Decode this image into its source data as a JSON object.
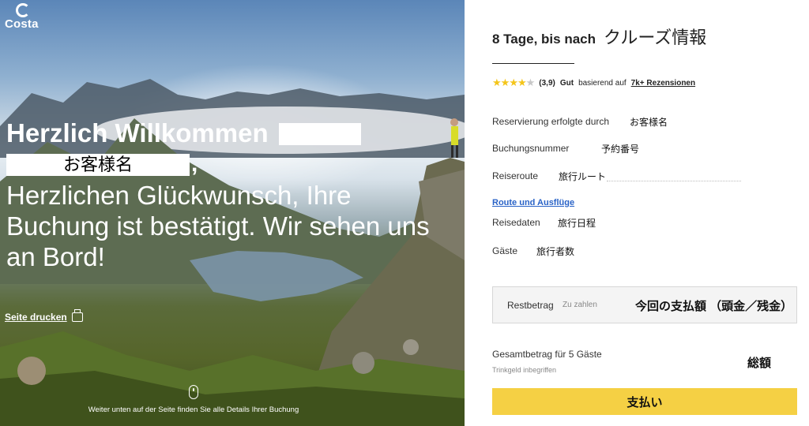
{
  "hero": {
    "logo_text": "Costa",
    "title": "Herzlich Willkommen",
    "name_placeholder": "お客様名",
    "comma": ",",
    "body": "Herzlichen Glückwunsch, Ihre Buchung ist bestätigt. Wir sehen uns an Bord!",
    "print_label": "Seite drucken",
    "scroll_hint": "Weiter unten auf der Seite finden Sie alle Details Ihrer Buchung"
  },
  "panel": {
    "title": "8 Tage, bis nach",
    "title_jp": "クルーズ情報",
    "rating": {
      "stars_filled": 4,
      "stars_total": 5,
      "score": "(3,9)",
      "word": "Gut",
      "based_on": "basierend auf",
      "reviews": "7k+ Rezensionen"
    },
    "rows": {
      "reservation_label": "Reservierung erfolgte durch",
      "reservation_value": "お客様名",
      "booking_label": "Buchungsnummer",
      "booking_value": "予約番号",
      "route_label": "Reiseroute",
      "route_value": "旅行ルート",
      "route_link": "Route und Ausflüge",
      "dates_label": "Reisedaten",
      "dates_value": "旅行日程",
      "guests_label": "Gäste",
      "guests_value": "旅行者数"
    },
    "rest": {
      "label": "Restbetrag",
      "sub": "Zu zahlen",
      "amount": "今回の支払額 （頭金／残金）"
    },
    "total": {
      "label": "Gesamtbetrag für 5 Gäste",
      "sub": "Trinkgeld inbegriffen",
      "amount": "総額"
    },
    "pay_button": "支払い"
  },
  "colors": {
    "accent_yellow": "#f5d044",
    "link_blue": "#2a63c7",
    "star_yellow": "#f4c51a"
  }
}
